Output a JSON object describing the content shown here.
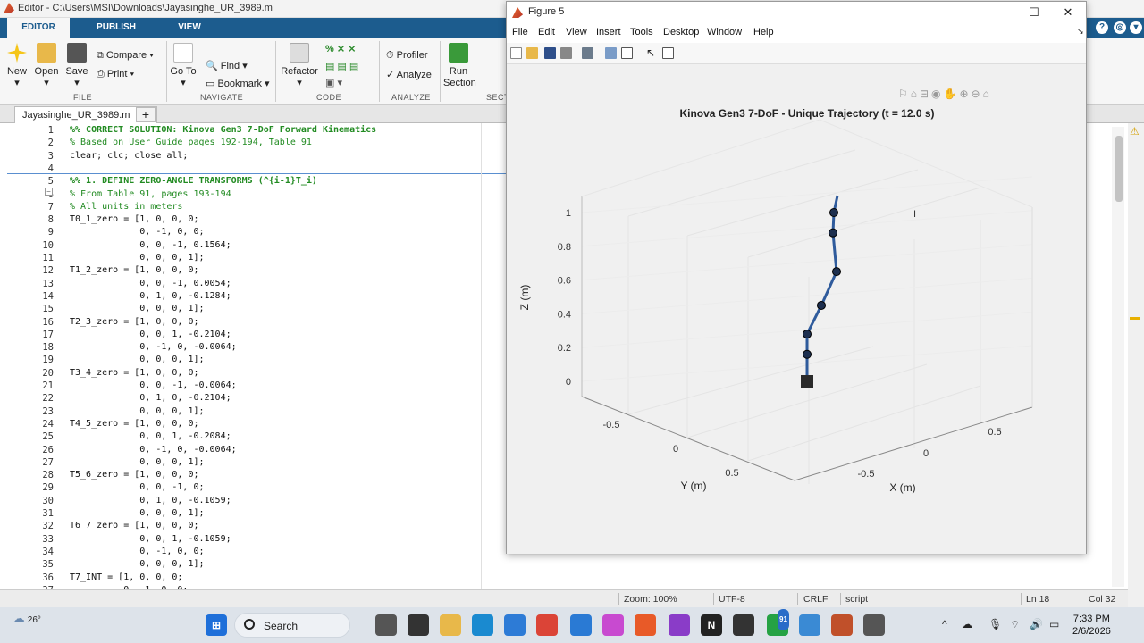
{
  "app": {
    "title": "Editor - C:\\Users\\MSI\\Downloads\\Jayasinghe_UR_3989.m"
  },
  "ribbon": {
    "tabs": [
      "EDITOR",
      "PUBLISH",
      "VIEW"
    ],
    "file": {
      "new": "New",
      "open": "Open",
      "save": "Save",
      "compare": "Compare",
      "print": "Print",
      "group": "FILE"
    },
    "navigate": {
      "goto": "Go To",
      "find": "Find",
      "bookmark": "Bookmark",
      "group": "NAVIGATE"
    },
    "code": {
      "refactor": "Refactor",
      "group": "CODE"
    },
    "analyze": {
      "profiler": "Profiler",
      "analyze": "Analyze",
      "group": "ANALYZE"
    },
    "section": {
      "run": "Run",
      "section": "Section",
      "group": "SECT"
    }
  },
  "editor": {
    "filename": "Jayasinghe_UR_3989.m",
    "lines": [
      {
        "n": "1",
        "t": "%% CORRECT SOLUTION: Kinova Gen3 7-DoF Forward Kinematics",
        "k": "cmb"
      },
      {
        "n": "2",
        "t": "% Based on User Guide pages 192-194, Table 91",
        "k": "cm"
      },
      {
        "n": "3",
        "t": "clear; clc; close all;",
        "k": ""
      },
      {
        "n": "4",
        "t": "",
        "k": ""
      },
      {
        "n": "5",
        "t": "%% 1. DEFINE ZERO-ANGLE TRANSFORMS (^{i-1}T_i)",
        "k": "cmb"
      },
      {
        "n": "6",
        "t": "% From Table 91, pages 193-194",
        "k": "cm"
      },
      {
        "n": "7",
        "t": "% All units in meters",
        "k": "cm"
      },
      {
        "n": "8",
        "t": "T0_1_zero = [1, 0, 0, 0;",
        "k": ""
      },
      {
        "n": "9",
        "t": "             0, -1, 0, 0;",
        "k": ""
      },
      {
        "n": "10",
        "t": "             0, 0, -1, 0.1564;",
        "k": ""
      },
      {
        "n": "11",
        "t": "             0, 0, 0, 1];",
        "k": ""
      },
      {
        "n": "12",
        "t": "T1_2_zero = [1, 0, 0, 0;",
        "k": ""
      },
      {
        "n": "13",
        "t": "             0, 0, -1, 0.0054;",
        "k": ""
      },
      {
        "n": "14",
        "t": "             0, 1, 0, -0.1284;",
        "k": ""
      },
      {
        "n": "15",
        "t": "             0, 0, 0, 1];",
        "k": ""
      },
      {
        "n": "16",
        "t": "T2_3_zero = [1, 0, 0, 0;",
        "k": ""
      },
      {
        "n": "17",
        "t": "             0, 0, 1, -0.2104;",
        "k": ""
      },
      {
        "n": "18",
        "t": "             0, -1, 0, -0.0064;",
        "k": ""
      },
      {
        "n": "19",
        "t": "             0, 0, 0, 1];",
        "k": ""
      },
      {
        "n": "20",
        "t": "T3_4_zero = [1, 0, 0, 0;",
        "k": ""
      },
      {
        "n": "21",
        "t": "             0, 0, -1, -0.0064;",
        "k": ""
      },
      {
        "n": "22",
        "t": "             0, 1, 0, -0.2104;",
        "k": ""
      },
      {
        "n": "23",
        "t": "             0, 0, 0, 1];",
        "k": ""
      },
      {
        "n": "24",
        "t": "T4_5_zero = [1, 0, 0, 0;",
        "k": ""
      },
      {
        "n": "25",
        "t": "             0, 0, 1, -0.2084;",
        "k": ""
      },
      {
        "n": "26",
        "t": "             0, -1, 0, -0.0064;",
        "k": ""
      },
      {
        "n": "27",
        "t": "             0, 0, 0, 1];",
        "k": ""
      },
      {
        "n": "28",
        "t": "T5_6_zero = [1, 0, 0, 0;",
        "k": ""
      },
      {
        "n": "29",
        "t": "             0, 0, -1, 0;",
        "k": ""
      },
      {
        "n": "30",
        "t": "             0, 1, 0, -0.1059;",
        "k": ""
      },
      {
        "n": "31",
        "t": "             0, 0, 0, 1];",
        "k": ""
      },
      {
        "n": "32",
        "t": "T6_7_zero = [1, 0, 0, 0;",
        "k": ""
      },
      {
        "n": "33",
        "t": "             0, 0, 1, -0.1059;",
        "k": ""
      },
      {
        "n": "34",
        "t": "             0, -1, 0, 0;",
        "k": ""
      },
      {
        "n": "35",
        "t": "             0, 0, 0, 1];",
        "k": ""
      },
      {
        "n": "36",
        "t": "T7_INT = [1, 0, 0, 0;",
        "k": ""
      },
      {
        "n": "37",
        "t": "          0, -1, 0, 0;",
        "k": ""
      }
    ]
  },
  "status": {
    "zoom": "Zoom: 100%",
    "encoding": "UTF-8",
    "eol": "CRLF",
    "type": "script",
    "ln": "Ln  18",
    "col": "Col  32"
  },
  "figure": {
    "title": "Figure 5",
    "menu": [
      "File",
      "Edit",
      "View",
      "Insert",
      "Tools",
      "Desktop",
      "Window",
      "Help"
    ],
    "min": "—",
    "max": "☐",
    "close": "✕"
  },
  "chart_data": {
    "type": "scatter",
    "title": "Kinova Gen3 7-DoF - Unique Trajectory (t = 12.0 s)",
    "xlabel": "X (m)",
    "ylabel": "Y (m)",
    "zlabel": "Z (m)",
    "z_ticks": [
      "0",
      "0.2",
      "0.4",
      "0.6",
      "0.8",
      "1"
    ],
    "y_ticks": [
      "-0.5",
      "0",
      "0.5"
    ],
    "x_ticks": [
      "-0.5",
      "0",
      "0.5"
    ],
    "zlim": [
      0,
      1.1
    ],
    "series": [
      {
        "z": [
          0,
          0.16,
          0.28,
          0.45,
          0.65,
          0.88,
          1.0,
          1.1
        ]
      }
    ],
    "grid": true
  },
  "taskbar": {
    "temp": "26°",
    "search": "Search",
    "time": "7:33 PM",
    "date": "2/6/2026",
    "badge": "91"
  }
}
